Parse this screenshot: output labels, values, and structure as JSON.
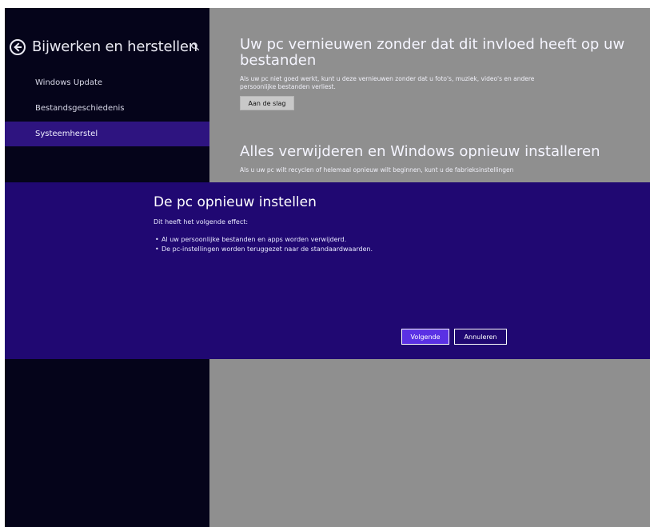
{
  "sidebar": {
    "title": "Bijwerken en herstellen",
    "items": [
      {
        "label": "Windows Update"
      },
      {
        "label": "Bestandsgeschiedenis"
      },
      {
        "label": "Systeemherstel"
      }
    ]
  },
  "main": {
    "refresh": {
      "title_line1": "Uw pc vernieuwen zonder dat dit invloed heeft op uw",
      "title_line2": "bestanden",
      "description": "Als uw pc niet goed werkt, kunt u deze vernieuwen zonder dat u foto's, muziek, video's en andere persoonlijke bestanden verliest.",
      "button_label": "Aan de slag"
    },
    "reset": {
      "title": "Alles verwijderen en Windows opnieuw installeren",
      "description": "Als u uw pc wilt recyclen of helemaal opnieuw wilt beginnen, kunt u de fabrieksinstellingen"
    }
  },
  "dialog": {
    "title": "De pc opnieuw instellen",
    "subtitle": "Dit heeft het volgende effect:",
    "effects": [
      "Al uw persoonlijke bestanden en apps worden verwijderd.",
      "De pc-instellingen worden teruggezet naar de standaardwaarden."
    ],
    "next_label": "Volgende",
    "cancel_label": "Annuleren"
  },
  "icons": {
    "back": "back-arrow-circle-icon",
    "search": "search-icon"
  },
  "colors": {
    "sidebar_background": "#05041a",
    "selected_nav": "#2e1480",
    "dialog_background": "#200872",
    "primary_button": "#5a31e4",
    "right_pane_overlay": "#8f8f8f"
  }
}
